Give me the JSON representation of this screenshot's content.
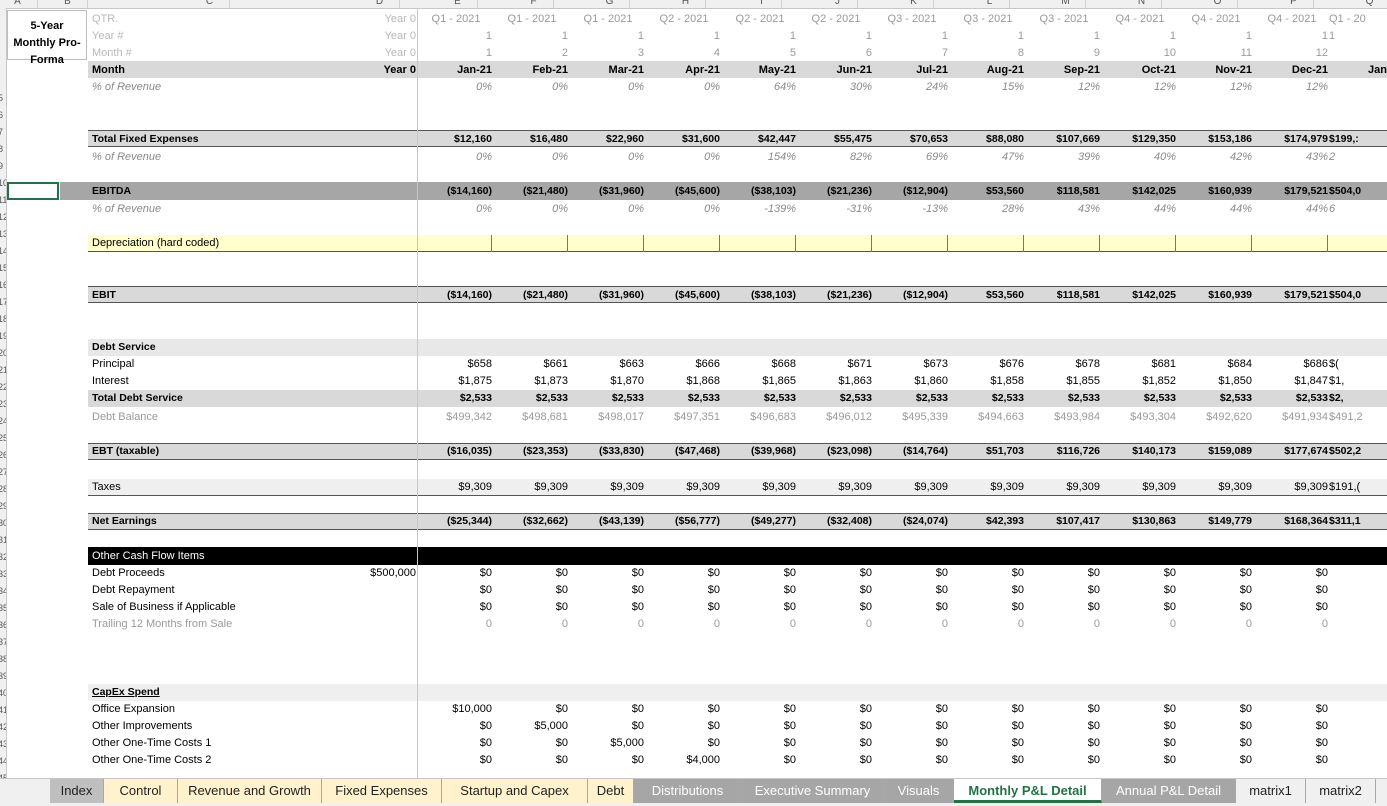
{
  "sheet": {
    "title_block": "5-Year Monthly Pro-Forma",
    "col_letters": [
      "A",
      "B",
      "C",
      "D",
      "E",
      "F",
      "G",
      "H",
      "I",
      "J",
      "K",
      "L",
      "M",
      "N",
      "O",
      "P",
      "Q"
    ],
    "row_numbers": [
      "5",
      "6",
      "7",
      "8",
      "9",
      "10",
      "11",
      "12",
      "13",
      "14",
      "15",
      "16",
      "17",
      "18",
      "19",
      "20",
      "21",
      "22",
      "23",
      "24",
      "25",
      "26",
      "27",
      "28",
      "29",
      "30",
      "31",
      "32",
      "33",
      "34",
      "35",
      "36",
      "37",
      "38",
      "39",
      "40",
      "41",
      "42",
      "43",
      "44",
      "45"
    ],
    "header": {
      "qtr_label": "QTR.",
      "year_label": "Year #",
      "month_num_label": "Month #",
      "month_label": "Month",
      "d_qtr": "Year 0",
      "d_year": "Year 0",
      "d_month_num": "Year 0",
      "d_month": "Year 0",
      "qtr": [
        "Q1 - 2021",
        "Q1 - 2021",
        "Q1 - 2021",
        "Q2 - 2021",
        "Q2 - 2021",
        "Q2 - 2021",
        "Q3 - 2021",
        "Q3 - 2021",
        "Q3 - 2021",
        "Q4 - 2021",
        "Q4 - 2021",
        "Q4 - 2021",
        "Q1 - 20"
      ],
      "year": [
        "1",
        "1",
        "1",
        "1",
        "1",
        "1",
        "1",
        "1",
        "1",
        "1",
        "1",
        "1",
        "1"
      ],
      "month_num": [
        "1",
        "2",
        "3",
        "4",
        "5",
        "6",
        "7",
        "8",
        "9",
        "10",
        "11",
        "12",
        ""
      ],
      "months": [
        "Jan-21",
        "Feb-21",
        "Mar-21",
        "Apr-21",
        "May-21",
        "Jun-21",
        "Jul-21",
        "Aug-21",
        "Sep-21",
        "Oct-21",
        "Nov-21",
        "Dec-21",
        "Jan"
      ]
    },
    "rows": {
      "pct_revenue_1": {
        "label": "% of Revenue",
        "values": [
          "0%",
          "0%",
          "0%",
          "0%",
          "64%",
          "30%",
          "24%",
          "15%",
          "12%",
          "12%",
          "12%",
          "12%",
          ""
        ]
      },
      "total_fixed": {
        "label": "Total Fixed Expenses",
        "values": [
          "$12,160",
          "$16,480",
          "$22,960",
          "$31,600",
          "$42,447",
          "$55,475",
          "$70,653",
          "$88,080",
          "$107,669",
          "$129,350",
          "$153,186",
          "$174,979",
          "$199,:"
        ]
      },
      "pct_revenue_2": {
        "label": "% of Revenue",
        "values": [
          "0%",
          "0%",
          "0%",
          "0%",
          "154%",
          "82%",
          "69%",
          "47%",
          "39%",
          "40%",
          "42%",
          "43%",
          "2"
        ]
      },
      "ebitda": {
        "label": "EBITDA",
        "values": [
          "($14,160)",
          "($21,480)",
          "($31,960)",
          "($45,600)",
          "($38,103)",
          "($21,236)",
          "($12,904)",
          "$53,560",
          "$118,581",
          "$142,025",
          "$160,939",
          "$179,521",
          "$504,0"
        ]
      },
      "pct_revenue_3": {
        "label": "% of Revenue",
        "values": [
          "0%",
          "0%",
          "0%",
          "0%",
          "-139%",
          "-31%",
          "-13%",
          "28%",
          "43%",
          "44%",
          "44%",
          "44%",
          "6"
        ]
      },
      "depreciation": {
        "label": "Depreciation (hard coded)"
      },
      "ebit": {
        "label": "EBIT",
        "values": [
          "($14,160)",
          "($21,480)",
          "($31,960)",
          "($45,600)",
          "($38,103)",
          "($21,236)",
          "($12,904)",
          "$53,560",
          "$118,581",
          "$142,025",
          "$160,939",
          "$179,521",
          "$504,0"
        ]
      },
      "debt_service": {
        "label": "Debt Service"
      },
      "principal": {
        "label": "Principal",
        "values": [
          "$658",
          "$661",
          "$663",
          "$666",
          "$668",
          "$671",
          "$673",
          "$676",
          "$678",
          "$681",
          "$684",
          "$686",
          "$("
        ]
      },
      "interest": {
        "label": "Interest",
        "values": [
          "$1,875",
          "$1,873",
          "$1,870",
          "$1,868",
          "$1,865",
          "$1,863",
          "$1,860",
          "$1,858",
          "$1,855",
          "$1,852",
          "$1,850",
          "$1,847",
          "$1,"
        ]
      },
      "total_debt": {
        "label": "Total Debt Service",
        "values": [
          "$2,533",
          "$2,533",
          "$2,533",
          "$2,533",
          "$2,533",
          "$2,533",
          "$2,533",
          "$2,533",
          "$2,533",
          "$2,533",
          "$2,533",
          "$2,533",
          "$2,"
        ]
      },
      "debt_balance": {
        "label": "Debt Balance",
        "values": [
          "$499,342",
          "$498,681",
          "$498,017",
          "$497,351",
          "$496,683",
          "$496,012",
          "$495,339",
          "$494,663",
          "$493,984",
          "$493,304",
          "$492,620",
          "$491,934",
          "$491,2"
        ]
      },
      "ebt": {
        "label": "EBT (taxable)",
        "values": [
          "($16,035)",
          "($23,353)",
          "($33,830)",
          "($47,468)",
          "($39,968)",
          "($23,098)",
          "($14,764)",
          "$51,703",
          "$116,726",
          "$140,173",
          "$159,089",
          "$177,674",
          "$502,2"
        ]
      },
      "taxes": {
        "label": "Taxes",
        "values": [
          "$9,309",
          "$9,309",
          "$9,309",
          "$9,309",
          "$9,309",
          "$9,309",
          "$9,309",
          "$9,309",
          "$9,309",
          "$9,309",
          "$9,309",
          "$9,309",
          "$191,("
        ]
      },
      "net_earnings": {
        "label": "Net Earnings",
        "values": [
          "($25,344)",
          "($32,662)",
          "($43,139)",
          "($56,777)",
          "($49,277)",
          "($32,408)",
          "($24,074)",
          "$42,393",
          "$107,417",
          "$130,863",
          "$149,779",
          "$168,364",
          "$311,1"
        ]
      },
      "other_cf": {
        "label": "Other Cash Flow Items"
      },
      "debt_proceeds": {
        "label": "Debt Proceeds",
        "d": "$500,000",
        "values": [
          "$0",
          "$0",
          "$0",
          "$0",
          "$0",
          "$0",
          "$0",
          "$0",
          "$0",
          "$0",
          "$0",
          "$0",
          ""
        ]
      },
      "debt_repayment": {
        "label": "Debt Repayment",
        "values": [
          "$0",
          "$0",
          "$0",
          "$0",
          "$0",
          "$0",
          "$0",
          "$0",
          "$0",
          "$0",
          "$0",
          "$0",
          ""
        ]
      },
      "sale_business": {
        "label": "Sale of Business if Applicable",
        "values": [
          "$0",
          "$0",
          "$0",
          "$0",
          "$0",
          "$0",
          "$0",
          "$0",
          "$0",
          "$0",
          "$0",
          "$0",
          ""
        ]
      },
      "trailing": {
        "label": "Trailing 12 Months from Sale",
        "values": [
          "0",
          "0",
          "0",
          "0",
          "0",
          "0",
          "0",
          "0",
          "0",
          "0",
          "0",
          "0",
          ""
        ]
      },
      "capex": {
        "label": "CapEx Spend"
      },
      "office_exp": {
        "label": "Office Expansion",
        "values": [
          "$10,000",
          "$0",
          "$0",
          "$0",
          "$0",
          "$0",
          "$0",
          "$0",
          "$0",
          "$0",
          "$0",
          "$0",
          ""
        ]
      },
      "other_impr": {
        "label": "Other Improvements",
        "values": [
          "$0",
          "$5,000",
          "$0",
          "$0",
          "$0",
          "$0",
          "$0",
          "$0",
          "$0",
          "$0",
          "$0",
          "$0",
          ""
        ]
      },
      "one_time_1": {
        "label": "Other One-Time Costs 1",
        "values": [
          "$0",
          "$0",
          "$5,000",
          "$0",
          "$0",
          "$0",
          "$0",
          "$0",
          "$0",
          "$0",
          "$0",
          "$0",
          ""
        ]
      },
      "one_time_2": {
        "label": "Other One-Time Costs 2",
        "values": [
          "$0",
          "$0",
          "$0",
          "$4,000",
          "$0",
          "$0",
          "$0",
          "$0",
          "$0",
          "$0",
          "$0",
          "$0",
          ""
        ]
      }
    }
  },
  "tabs": [
    "Index",
    "Control",
    "Revenue and Growth",
    "Fixed Expenses",
    "Startup and Capex",
    "Debt",
    "Distributions",
    "Executive Summary",
    "Visuals",
    "Monthly P&L Detail",
    "Annual P&L Detail",
    "matrix1",
    "matrix2"
  ],
  "active_tab": "Monthly P&L Detail",
  "colors": {
    "accent": "#217346",
    "yellow": "#ffffcc",
    "gray_band": "#d9d9d9",
    "ebitda_band": "#a6a6a6",
    "black_band": "#000000",
    "tab_yellow": "#fff2cc",
    "tab_gray": "#7f7f7f"
  }
}
